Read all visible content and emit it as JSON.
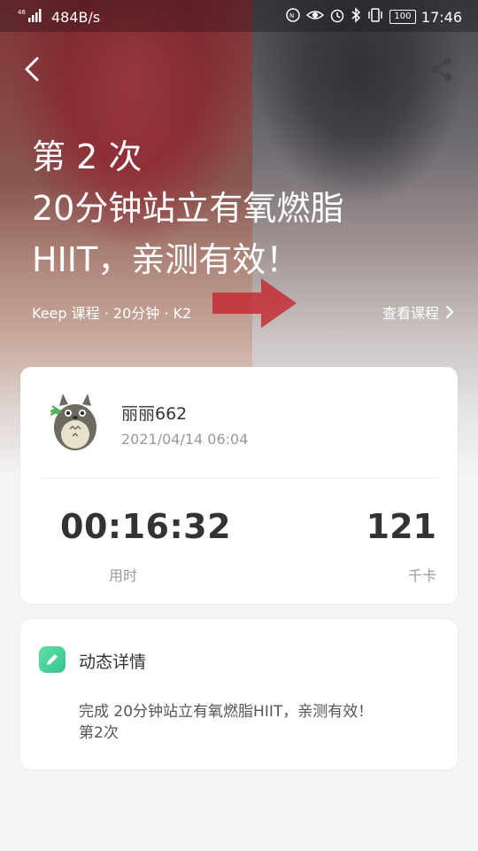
{
  "statusbar": {
    "network": "46",
    "speed": "484B/s",
    "battery": "100",
    "time": "17:46"
  },
  "colors": {
    "accent_green": "#34c58c",
    "hero_red": "#b23b46",
    "hero_dark": "#45424a"
  },
  "hero": {
    "title_line1": "第 2 次",
    "title_line2": "20分钟站立有氧燃脂",
    "title_line3": "HIIT，亲测有效！",
    "meta": "Keep 课程 · 20分钟 · K2",
    "view_course": "查看课程"
  },
  "icons": {
    "back": "back-arrow-icon",
    "share": "share-icon",
    "chevron": "chevron-right-icon",
    "edit": "edit-pencil-icon",
    "avatar": "totoro-avatar"
  },
  "user": {
    "name": "丽丽662",
    "datetime": "2021/04/14 06:04"
  },
  "stats": {
    "duration": "00:16:32",
    "duration_label": "用时",
    "calories": "121",
    "calories_label": "千卡"
  },
  "detail": {
    "title": "动态详情",
    "body_line1": "完成 20分钟站立有氧燃脂HIIT，亲测有效！",
    "body_line2": "第2次"
  }
}
